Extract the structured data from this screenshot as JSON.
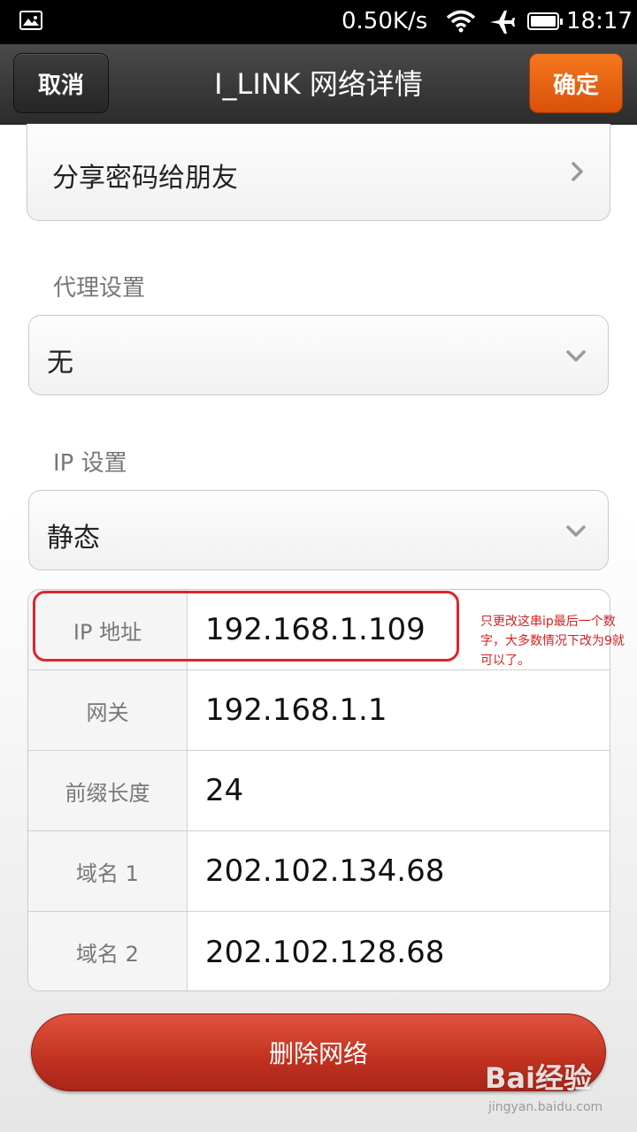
{
  "status_bar": {
    "speed": "0.50K/s",
    "time": "18:17",
    "icons": [
      "image-icon",
      "wifi-icon",
      "airplane-icon",
      "battery-icon"
    ]
  },
  "title_bar": {
    "cancel_label": "取消",
    "title": "I_LINK 网络详情",
    "confirm_label": "确定"
  },
  "share_row": {
    "label": "分享密码给朋友"
  },
  "proxy": {
    "section_label": "代理设置",
    "selected": "无"
  },
  "ip_settings": {
    "section_label": "IP 设置",
    "selected": "静态"
  },
  "ip_table": {
    "rows": [
      {
        "label": "IP 地址",
        "value": "192.168.1.109"
      },
      {
        "label": "网关",
        "value": "192.168.1.1"
      },
      {
        "label": "前缀长度",
        "value": "24"
      },
      {
        "label": "域名 1",
        "value": "202.102.134.68"
      },
      {
        "label": "域名 2",
        "value": "202.102.128.68"
      }
    ]
  },
  "annotation": {
    "text": "只更改这串ip最后一个数字，大多数情况下改为9就可以了。",
    "color": "#d81e1e"
  },
  "delete_button": {
    "label": "删除网络"
  },
  "watermark": {
    "main": "Bai经验",
    "sub": "jingyan.baidu.com"
  },
  "colors": {
    "accent_orange": "#e8650f",
    "delete_red": "#c1311f",
    "highlight_red": "#e0242c"
  }
}
